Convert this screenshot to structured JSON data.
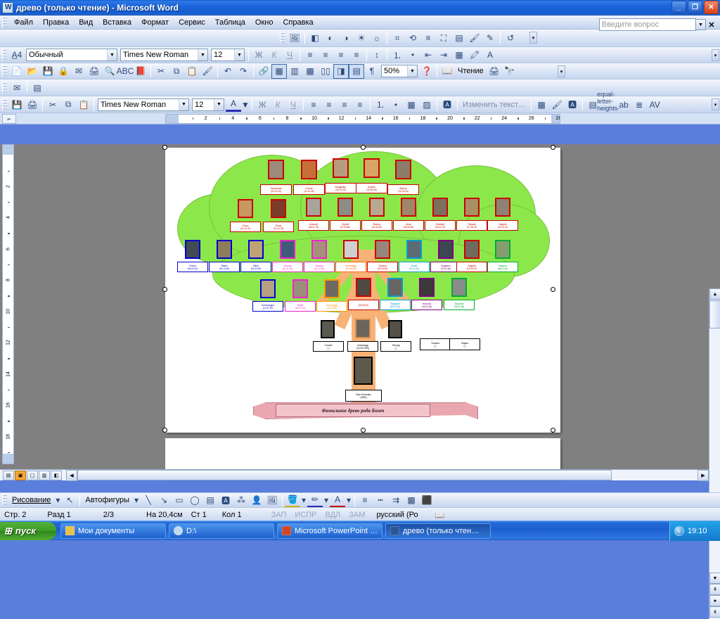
{
  "window": {
    "title": "древо (только чтение) - Microsoft Word",
    "app_icon": "word-document-icon",
    "minimize": "_",
    "maximize": "❐",
    "close": "✕"
  },
  "menubar": {
    "items": [
      {
        "label": "Файл"
      },
      {
        "label": "Правка"
      },
      {
        "label": "Вид"
      },
      {
        "label": "Вставка"
      },
      {
        "label": "Формат"
      },
      {
        "label": "Сервис"
      },
      {
        "label": "Таблица"
      },
      {
        "label": "Окно"
      },
      {
        "label": "Справка"
      }
    ]
  },
  "ask_box": {
    "placeholder": "Введите вопрос",
    "close_label": "✕"
  },
  "picture_toolbar": {
    "icons": [
      "insert-picture-icon",
      "color-icon",
      "more-contrast-icon",
      "less-contrast-icon",
      "more-brightness-icon",
      "less-brightness-icon",
      "crop-icon",
      "rotate-left-icon",
      "line-style-icon",
      "compress-picture-icon",
      "text-wrapping-icon",
      "format-picture-icon",
      "set-transparent-color-icon",
      "reset-picture-icon"
    ],
    "overflow": "▾"
  },
  "formatting_toolbar": {
    "style_icon": "style-icon",
    "style": "Обычный",
    "font": "Times New Roman",
    "size": "12",
    "bold": "Ж",
    "italic": "К",
    "underline": "Ч",
    "align_icons": [
      "align-left-icon",
      "align-center-icon",
      "align-right-icon",
      "justify-icon"
    ],
    "list_icons": [
      "numbered-list-icon",
      "bulleted-list-icon",
      "decrease-indent-icon",
      "increase-indent-icon"
    ],
    "border_icon": "borders-icon",
    "highlight_icon": "highlight-icon",
    "fontcolor_icon": "font-color-icon",
    "overflow": "▾"
  },
  "standard_toolbar": {
    "icons": [
      "new-icon",
      "open-icon",
      "save-icon",
      "permission-icon",
      "mail-icon",
      "print-icon",
      "print-preview-icon",
      "spelling-icon",
      "research-icon",
      "cut-icon",
      "copy-icon",
      "paste-icon",
      "format-painter-icon",
      "undo-icon",
      "redo-icon",
      "hyperlink-icon",
      "tables-borders-icon",
      "insert-table-icon",
      "insert-excel-icon",
      "columns-icon",
      "drawing-icon",
      "document-map-icon",
      "show-formatting-icon"
    ],
    "zoom": "50%",
    "help_icon": "help-icon",
    "read_label": "Чтение",
    "read_icon": "read-book-icon",
    "print_icon": "print-icon",
    "find_icon": "binoculars-icon",
    "overflow": "▾"
  },
  "wordart_toolbar": {
    "font": "Times New Roman",
    "size": "12",
    "fontcolor_icon": "font-color-icon",
    "bold": "Ж",
    "italic": "К",
    "underline": "Ч",
    "edit_text_label": "Изменить текст…",
    "gallery_icon": "wordart-gallery-icon",
    "format_icon": "format-wordart-icon",
    "shape_icon": "wordart-shape-icon",
    "letters_icon": "equal-letter-heights-icon",
    "vertical_icon": "vertical-text-icon",
    "align_icon": "wordart-alignment-icon",
    "spacing_icon": "character-spacing-icon",
    "overflow": "▾"
  },
  "ruler": {
    "corner_icon": "tab-stop-icon",
    "h_ticks": [
      "2",
      "4",
      "6",
      "8",
      "10",
      "12",
      "14",
      "16",
      "18",
      "20",
      "22",
      "24",
      "26",
      "28"
    ],
    "v_ticks": [
      "2",
      "4",
      "6",
      "8",
      "10",
      "12",
      "14",
      "16",
      "18"
    ]
  },
  "drawing_toolbar": {
    "menu_label": "Рисование",
    "select_icon": "select-objects-icon",
    "autoshapes_label": "Автофигуры",
    "icons": [
      "line-icon",
      "arrow-icon",
      "rectangle-icon",
      "oval-icon",
      "text-box-icon",
      "wordart-icon",
      "diagram-icon",
      "clip-art-icon",
      "picture-icon",
      "fill-color-icon",
      "line-color-icon",
      "font-color-icon",
      "line-style-icon",
      "dash-style-icon",
      "arrow-style-icon",
      "shadow-style-icon",
      "3d-style-icon"
    ]
  },
  "statusbar": {
    "page": "Стр. 2",
    "section": "Разд 1",
    "pages": "2/3",
    "at": "На 20,4см",
    "line": "Ст 1",
    "col": "Кол 1",
    "rec": "ЗАП",
    "trk": "ИСПР",
    "ext": "ВДЛ",
    "ovr": "ЗАМ",
    "language": "русский (Ро",
    "spell_icon": "spelling-status-icon"
  },
  "view_buttons": {
    "icons": [
      "normal-view-icon",
      "web-layout-view-icon",
      "print-layout-view-icon",
      "outline-view-icon",
      "reading-layout-view-icon"
    ],
    "active_index": 1
  },
  "taskbar": {
    "start_label": "пуск",
    "start_icon": "windows-logo-icon",
    "tasks": [
      {
        "label": "Мои документы",
        "icon": "folder-icon",
        "active": false
      },
      {
        "label": "D:\\",
        "icon": "drive-icon",
        "active": false
      },
      {
        "label": "Microsoft PowerPoint …",
        "icon": "powerpoint-icon",
        "active": false
      },
      {
        "label": "древо (только чтен…",
        "icon": "word-icon",
        "active": true
      }
    ],
    "tray_icon": "show-hidden-icons-icon",
    "clock": "19:10"
  },
  "document": {
    "banner_title": "Фамильное древо рода Богач",
    "tree": {
      "generations": [
        {
          "row": 1,
          "people": [
            {
              "name": "Екатерина",
              "date": "(04.12.03)",
              "color": "#cc0000"
            },
            {
              "name": "Степан",
              "date": "(12.01.06)",
              "color": "#cc0000"
            },
            {
              "name": "Владимир",
              "date": "(18.10.04)",
              "color": "#cc0000"
            },
            {
              "name": "Ксения",
              "date": "(28.05.05)",
              "color": "#cc0000"
            },
            {
              "name": "Виктор",
              "date": "(12.03.04)",
              "color": "#cc0000"
            }
          ]
        },
        {
          "row": 2,
          "people": [
            {
              "name": "Ольга",
              "date": "(10.12.76)",
              "color": "#cc0000"
            },
            {
              "name": "Юлия",
              "date": "(21.04.78)",
              "color": "#cc0000"
            },
            {
              "name": "Алексей",
              "date": "(28.01.79)",
              "color": "#cc0000"
            },
            {
              "name": "Сергей",
              "date": "(07.05.80)",
              "color": "#cc0000"
            },
            {
              "name": "Виктор",
              "date": "(14.03.81)",
              "color": "#cc0000"
            },
            {
              "name": "Анна",
              "date": "(09.09.82)",
              "color": "#cc0000"
            },
            {
              "name": "Евгений",
              "date": "(03.02.75)",
              "color": "#cc0000"
            },
            {
              "name": "Татьяна",
              "date": "(17.08.73)",
              "color": "#cc0000"
            },
            {
              "name": "Андрей",
              "date": "(22.04.74)",
              "color": "#cc0000"
            }
          ]
        },
        {
          "row": 3,
          "people": [
            {
              "name": "Елена",
              "date": "(06.02.61)",
              "color": "#0000cc"
            },
            {
              "name": "Павел",
              "date": "(04.12.60)",
              "color": "#0000cc"
            },
            {
              "name": "Иван",
              "date": "(06.11.59)",
              "color": "#0000cc"
            },
            {
              "name": "Ксения",
              "date": "(14.11.63)",
              "color": "#ee22cc"
            },
            {
              "name": "Тамара",
              "date": "(21.12.52)",
              "color": "#ee22cc"
            },
            {
              "name": "Александр",
              "date": "(01.09.53)",
              "color": "#ff6600"
            },
            {
              "name": "Татьяна",
              "date": "(25.06.50)",
              "color": "#cc0000"
            },
            {
              "name": "Юрий",
              "date": "(29.12.51)",
              "color": "#00a0cc"
            },
            {
              "name": "Людмила",
              "date": "(03.02.56)",
              "color": "#800080"
            },
            {
              "name": "Андрей",
              "date": "(14.09.57)",
              "color": "#cc0000"
            },
            {
              "name": "Марина",
              "date": "(08.01.48)",
              "color": "#00aa33"
            }
          ]
        },
        {
          "row": 4,
          "people": [
            {
              "name": "Александра",
              "date": "(12.07.40)",
              "color": "#0000cc"
            },
            {
              "name": "Юрий",
              "date": "(15.07.41)",
              "color": "#ee22cc"
            },
            {
              "name": "Александр",
              "date": "(20.03.46)",
              "color": "#ff9900"
            },
            {
              "name": "",
              "date": "(25.06.42)",
              "color": "#cc0000"
            },
            {
              "name": "Людмила",
              "date": "(29.12.51)",
              "color": "#00a0cc"
            },
            {
              "name": "Наталья",
              "date": "(03.02.56)",
              "color": "#800080"
            },
            {
              "name": "Василий",
              "date": "(08.01.48)",
              "color": "#00aa33"
            }
          ]
        },
        {
          "row": 5,
          "people": [
            {
              "name": "Степан",
              "date": "(          )",
              "color": "#000000"
            },
            {
              "name": "Александр",
              "date": "(10.05.1906)",
              "color": "#000000"
            },
            {
              "name": "Леонид",
              "date": "(          )",
              "color": "#000000"
            },
            {
              "name": "Татьяна",
              "date": "(          )",
              "color": "#000000"
            },
            {
              "name": "Мария",
              "date": "(          )",
              "color": "#000000"
            }
          ]
        },
        {
          "row": 6,
          "people": [
            {
              "name": "Петр Егорович",
              "date": "(1881)",
              "color": "#000000"
            }
          ]
        }
      ]
    }
  }
}
